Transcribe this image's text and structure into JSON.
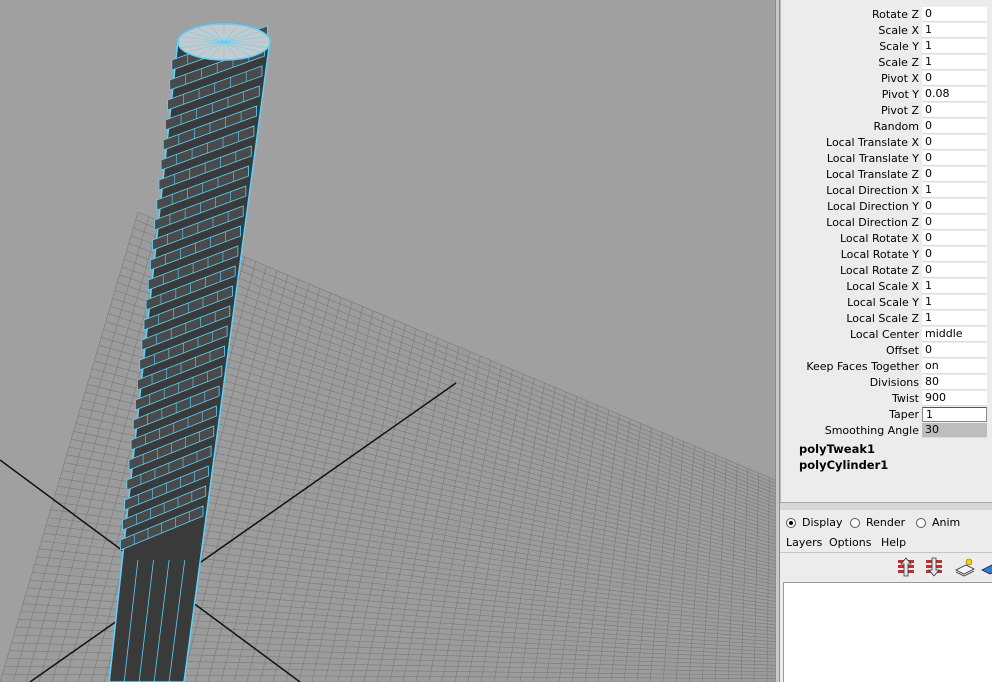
{
  "attributes": [
    {
      "label": "Rotate Z",
      "value": "0"
    },
    {
      "label": "Scale X",
      "value": "1"
    },
    {
      "label": "Scale Y",
      "value": "1"
    },
    {
      "label": "Scale Z",
      "value": "1"
    },
    {
      "label": "Pivot X",
      "value": "0"
    },
    {
      "label": "Pivot Y",
      "value": "0.08"
    },
    {
      "label": "Pivot Z",
      "value": "0"
    },
    {
      "label": "Random",
      "value": "0"
    },
    {
      "label": "Local Translate X",
      "value": "0"
    },
    {
      "label": "Local Translate Y",
      "value": "0"
    },
    {
      "label": "Local Translate Z",
      "value": "0"
    },
    {
      "label": "Local Direction X",
      "value": "1"
    },
    {
      "label": "Local Direction Y",
      "value": "0"
    },
    {
      "label": "Local Direction Z",
      "value": "0"
    },
    {
      "label": "Local Rotate X",
      "value": "0"
    },
    {
      "label": "Local Rotate Y",
      "value": "0"
    },
    {
      "label": "Local Rotate Z",
      "value": "0"
    },
    {
      "label": "Local Scale X",
      "value": "1"
    },
    {
      "label": "Local Scale Y",
      "value": "1"
    },
    {
      "label": "Local Scale Z",
      "value": "1"
    },
    {
      "label": "Local Center",
      "value": "middle"
    },
    {
      "label": "Offset",
      "value": "0"
    },
    {
      "label": "Keep Faces Together",
      "value": "on"
    },
    {
      "label": "Divisions",
      "value": "80"
    },
    {
      "label": "Twist",
      "value": "900"
    },
    {
      "label": "Taper",
      "value": "1"
    },
    {
      "label": "Smoothing Angle",
      "value": "30"
    }
  ],
  "nodes": [
    "polyTweak1",
    "polyCylinder1"
  ],
  "layer_editor": {
    "modes": [
      "Display",
      "Render",
      "Anim"
    ],
    "selected_mode": "Display",
    "menus": [
      "Layers",
      "Options",
      "Help"
    ]
  },
  "colors": {
    "viewport_bg": "#a0a0a0",
    "grid_line": "#7a7a7a",
    "wireframe": "#59d3ff",
    "mesh_fill": "#3a3a3a"
  }
}
